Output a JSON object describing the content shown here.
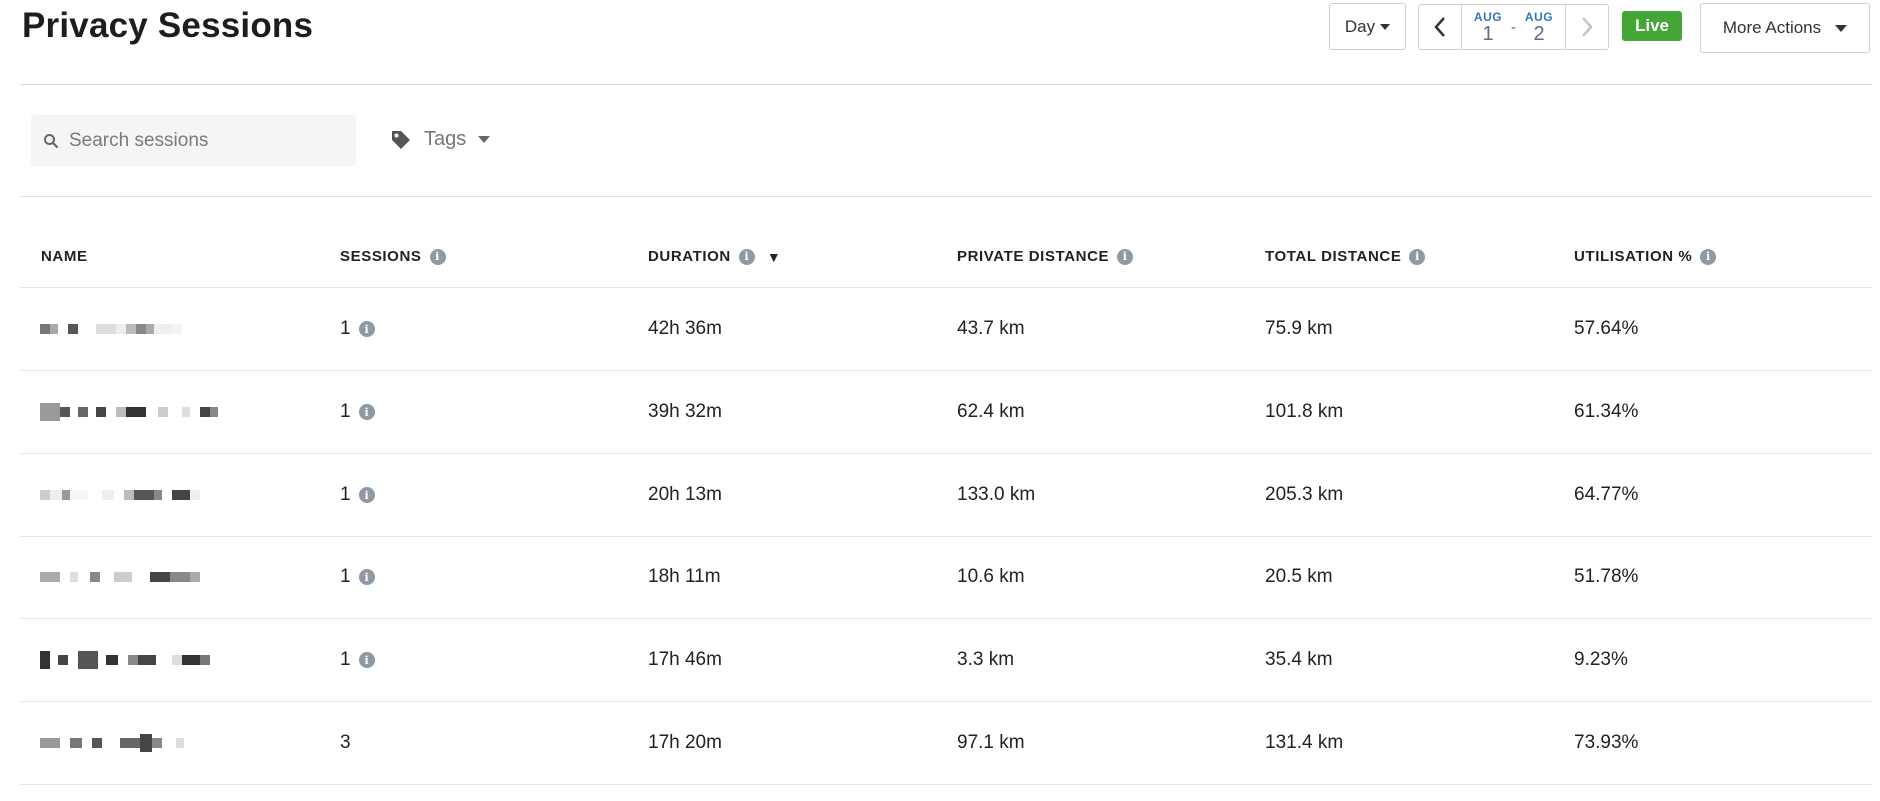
{
  "page": {
    "title": "Privacy Sessions"
  },
  "toolbar": {
    "period_label": "Day",
    "date_from": {
      "month": "AUG",
      "day": "1"
    },
    "date_sep": "-",
    "date_to": {
      "month": "AUG",
      "day": "2"
    },
    "live_label": "Live",
    "more_actions_label": "More Actions"
  },
  "filters": {
    "search_placeholder": "Search sessions",
    "search_value": "",
    "tags_label": "Tags"
  },
  "table": {
    "columns": [
      {
        "label": "NAME",
        "info": false,
        "sorted": false
      },
      {
        "label": "SESSIONS",
        "info": true,
        "sorted": false
      },
      {
        "label": "DURATION",
        "info": true,
        "sorted": true
      },
      {
        "label": "PRIVATE DISTANCE",
        "info": true,
        "sorted": false
      },
      {
        "label": "TOTAL DISTANCE",
        "info": true,
        "sorted": false
      },
      {
        "label": "UTILISATION %",
        "info": true,
        "sorted": false
      }
    ],
    "sort_indicator": "▼",
    "info_glyph": "i",
    "rows": [
      {
        "sessions": "1",
        "sessions_info": true,
        "duration": "42h 36m",
        "private_distance": "43.7 km",
        "total_distance": "75.9 km",
        "utilisation": "57.64%"
      },
      {
        "sessions": "1",
        "sessions_info": true,
        "duration": "39h 32m",
        "private_distance": "62.4 km",
        "total_distance": "101.8 km",
        "utilisation": "61.34%"
      },
      {
        "sessions": "1",
        "sessions_info": true,
        "duration": "20h 13m",
        "private_distance": "133.0 km",
        "total_distance": "205.3 km",
        "utilisation": "64.77%"
      },
      {
        "sessions": "1",
        "sessions_info": true,
        "duration": "18h 11m",
        "private_distance": "10.6 km",
        "total_distance": "20.5 km",
        "utilisation": "51.78%"
      },
      {
        "sessions": "1",
        "sessions_info": true,
        "duration": "17h 46m",
        "private_distance": "3.3 km",
        "total_distance": "35.4 km",
        "utilisation": "9.23%"
      },
      {
        "sessions": "3",
        "sessions_info": false,
        "duration": "17h 20m",
        "private_distance": "97.1 km",
        "total_distance": "131.4 km",
        "utilisation": "73.93%"
      }
    ]
  },
  "colors": {
    "live_green": "#43a637",
    "date_month_blue": "#2f76c7",
    "info_icon_gray": "#8e99a4"
  },
  "icons": {
    "search": "search-icon",
    "tag": "tag-icon",
    "prev": "chevron-left-icon",
    "next": "chevron-right-icon",
    "info": "info-icon",
    "caret": "caret-down-icon"
  }
}
